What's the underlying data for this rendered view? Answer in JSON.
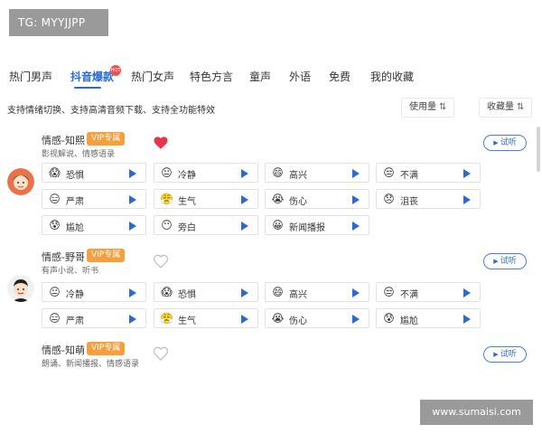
{
  "watermarks": {
    "top": "TG: MYYJJPP",
    "bottom": "www.sumaisi.com"
  },
  "tabs": [
    {
      "label": "热门男声",
      "active": false
    },
    {
      "label": "抖音爆款",
      "active": true,
      "badge": "hot"
    },
    {
      "label": "热门女声",
      "active": false
    },
    {
      "label": "特色方言",
      "active": false
    },
    {
      "label": "童声",
      "active": false
    },
    {
      "label": "外语",
      "active": false
    },
    {
      "label": "免费",
      "active": false
    },
    {
      "label": "我的收藏",
      "active": false
    }
  ],
  "subtitle": "支持情绪切换、支持高清音频下载、支持全功能特效",
  "sort": {
    "usage": "使用量",
    "favorites": "收藏量",
    "arrows_glyph": "⇅"
  },
  "listen_label": "试听",
  "voices": [
    {
      "name": "情感-知熙",
      "vip": "VIP专属",
      "desc": "影视解说、情感语录",
      "favorited": true,
      "emotions": [
        {
          "label": "恐惧",
          "emoji": "😱"
        },
        {
          "label": "冷静",
          "emoji": "😐"
        },
        {
          "label": "高兴",
          "emoji": "😄"
        },
        {
          "label": "不满",
          "emoji": "😒"
        },
        {
          "label": "严肃",
          "emoji": "😑"
        },
        {
          "label": "生气",
          "emoji": "😤"
        },
        {
          "label": "伤心",
          "emoji": "😭"
        },
        {
          "label": "沮丧",
          "emoji": "😞"
        },
        {
          "label": "尴尬",
          "emoji": "😰"
        },
        {
          "label": "旁白",
          "emoji": "😶"
        },
        {
          "label": "新闻播报",
          "emoji": "😀"
        }
      ]
    },
    {
      "name": "情感-野哥",
      "vip": "VIP专属",
      "desc": "有声小说、听书",
      "favorited": false,
      "emotions": [
        {
          "label": "冷静",
          "emoji": "😐"
        },
        {
          "label": "恐惧",
          "emoji": "😱"
        },
        {
          "label": "高兴",
          "emoji": "😄"
        },
        {
          "label": "不满",
          "emoji": "😒"
        },
        {
          "label": "严肃",
          "emoji": "😑"
        },
        {
          "label": "生气",
          "emoji": "😤"
        },
        {
          "label": "伤心",
          "emoji": "😭"
        },
        {
          "label": "尴尬",
          "emoji": "😰"
        }
      ]
    },
    {
      "name": "情感-知萌",
      "vip": "VIP专属",
      "desc": "朗诵、新闻播报、情感语录",
      "favorited": false,
      "emotions": []
    }
  ],
  "colors": {
    "accent": "#2a6ad8",
    "vip": "#f6a03d",
    "heart": "#e8344a",
    "hot": "#f05050"
  }
}
